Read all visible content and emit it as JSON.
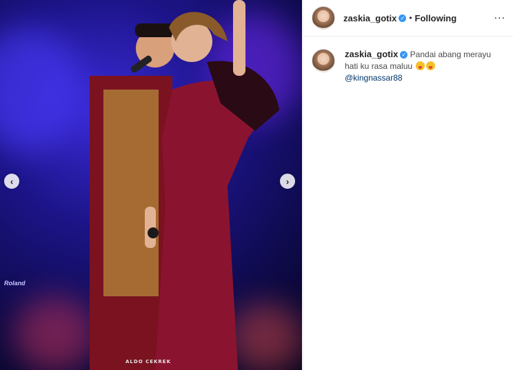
{
  "post": {
    "username": "zaskia_gotix",
    "follow_status": "Following",
    "separator": "•",
    "more_icon": "...",
    "caption_user": "zaskia_gotix",
    "caption_text": "Pandai abang merayu hati ku rasa maluu",
    "mention": "@kingnassar88",
    "photo_watermark": "ALDO CEKREK",
    "stage_brand": "Roland",
    "nav_prev": "‹",
    "nav_next": "›",
    "verified_mark": "✓"
  },
  "colors": {
    "verified": "#3897f0",
    "mention": "#003569",
    "divider": "#efefef",
    "stage_blue": "#1c1488",
    "dress": "#8a1430"
  }
}
